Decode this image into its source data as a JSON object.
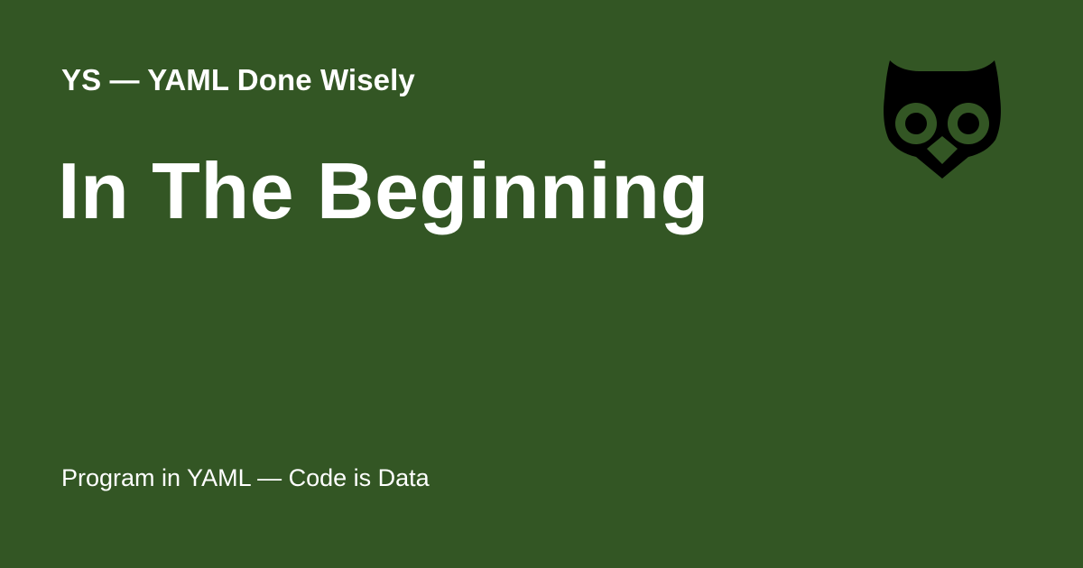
{
  "site_name": "YS — YAML Done Wisely",
  "page_title": "In The Beginning",
  "tagline": "Program in YAML — Code is Data",
  "logo_icon": "owl-icon",
  "colors": {
    "background": "#335624",
    "text": "#ffffff",
    "logo": "#000000"
  }
}
